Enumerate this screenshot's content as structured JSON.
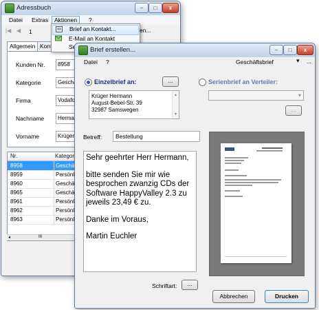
{
  "adressbuch": {
    "title": "Adressbuch",
    "menu": [
      "Datei",
      "Extras",
      "Aktionen",
      "?"
    ],
    "record_nav": {
      "current": "1",
      "prev_icons": [
        "|◀",
        "◀"
      ]
    },
    "tabs": [
      "Allgemein",
      "Kont"
    ],
    "fields": [
      {
        "label": "Kunden Nr.",
        "value": "8958"
      },
      {
        "label": "Kategorie",
        "value": "Geschä"
      },
      {
        "label": "Firma",
        "value": "Vodafor"
      },
      {
        "label": "Nachname",
        "value": "Herman"
      },
      {
        "label": "Vorname",
        "value": "Krüger"
      }
    ],
    "grid": {
      "columns": [
        "Nr.",
        "Kategorie"
      ],
      "rows": [
        [
          "8958",
          "Geschäftl"
        ],
        [
          "8959",
          "Persönlich"
        ],
        [
          "8960",
          "Geschäftl"
        ],
        [
          "8965",
          "Geschäftl"
        ],
        [
          "8961",
          "Persönlich"
        ],
        [
          "8962",
          "Persönlich"
        ],
        [
          "8963",
          "Persönlich"
        ]
      ],
      "selected_index": 0
    },
    "scroll_thumb": "III"
  },
  "dropdown": {
    "items": [
      {
        "label": "Brief an Kontakt...",
        "icon": "letter-icon"
      },
      {
        "label": "E-Mail an Kontakt",
        "icon": "email-icon"
      },
      {
        "label": "Se",
        "icon": ""
      }
    ],
    "trailing_text": "en..."
  },
  "brief": {
    "title": "Brief erstellen...",
    "menu": [
      "Datei",
      "?"
    ],
    "template_select": "Geschäftsbrief",
    "template_more": "...",
    "einzelbrief_label": "Einzelbrief an:",
    "serienbrief_label": "Serienbrief an Verteiler:",
    "dots_button": "...",
    "address_lines": [
      "Krüger Hermann",
      "August-Bebel-Str. 39",
      "32987 Samswegen"
    ],
    "betreff_label": "Betreff:",
    "betreff_value": "Bestellung",
    "body_paragraphs": [
      "Sehr geehrter Herr Hermann,",
      "bitte senden Sie mir wie besprochen zwanzig CDs der Software HappyValley 2.3 zu jeweils 23,49 € zu.",
      "Danke im Voraus,",
      "Martin Euchler"
    ],
    "schriftart_label": "Schriftart:",
    "schriftart_button": "...",
    "abbrechen": "Abbrechen",
    "drucken": "Drucken"
  },
  "window_controls": {
    "minimize": "–",
    "maximize": "□",
    "close": "x"
  },
  "colors": {
    "title_gradient": "#c3d4e8",
    "selection": "#3399ff",
    "radio_label": "#1a2e8a",
    "preview_bg": "#7a7a7a"
  }
}
